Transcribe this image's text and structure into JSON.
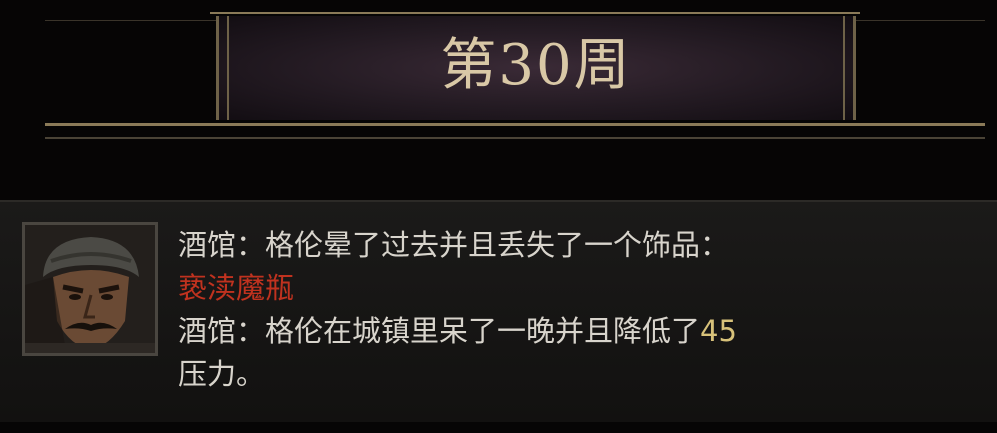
{
  "banner": {
    "week_title": "第30周"
  },
  "event_log": {
    "portrait_icon": "hero-portrait-icon",
    "lines": [
      {
        "text": "酒馆：格伦晕了过去并且丢失了一个饰品："
      },
      {
        "text": "亵渎魔瓶",
        "color": "#c0321f"
      },
      {
        "text": "酒馆：格伦在城镇里呆了一晚并且降低了",
        "value": "45"
      },
      {
        "text": "压力。"
      }
    ]
  },
  "colors": {
    "banner_text": "#d9c8a6",
    "log_text": "#d8d4cc",
    "item_name": "#c0321f",
    "number_highlight": "#d8c27a"
  }
}
